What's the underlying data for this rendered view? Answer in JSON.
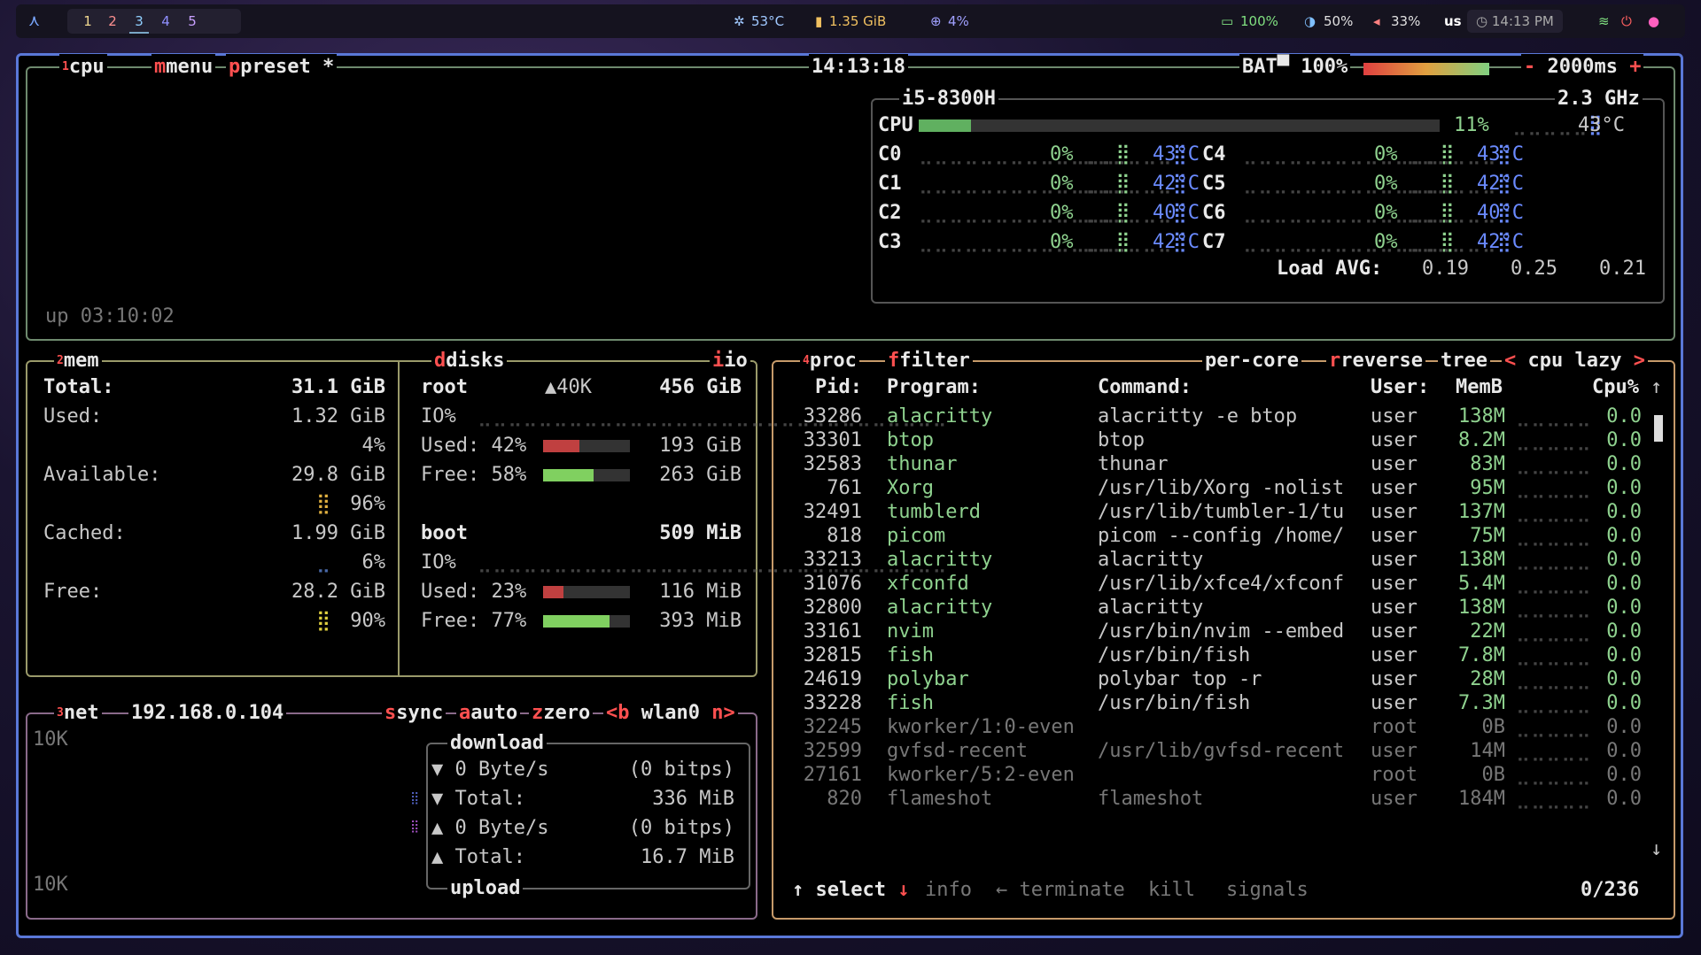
{
  "polybar": {
    "workspaces": [
      "1",
      "2",
      "3",
      "4",
      "5"
    ],
    "temp": "53°C",
    "mem": "1.35 GiB",
    "cpu": "4%",
    "battery": "100%",
    "brightness": "50%",
    "volume": "33%",
    "keyboard": "us",
    "clock": "14:13 PM"
  },
  "cpu": {
    "title": "cpu",
    "menu": "menu",
    "preset": "preset *",
    "clock": "14:13:18",
    "bat": "BAT▀ 100%",
    "interval": "2000ms",
    "model": "i5-8300H",
    "freq": "2.3 GHz",
    "total_label": "CPU",
    "total_pct": "11%",
    "total_temp": "43°C",
    "uptime": "up 03:10:02",
    "cores": [
      {
        "name": "C0",
        "pct": "0%",
        "temp": "43°C"
      },
      {
        "name": "C1",
        "pct": "0%",
        "temp": "42°C"
      },
      {
        "name": "C2",
        "pct": "0%",
        "temp": "40°C"
      },
      {
        "name": "C3",
        "pct": "0%",
        "temp": "42°C"
      },
      {
        "name": "C4",
        "pct": "0%",
        "temp": "43°C"
      },
      {
        "name": "C5",
        "pct": "0%",
        "temp": "42°C"
      },
      {
        "name": "C6",
        "pct": "0%",
        "temp": "40°C"
      },
      {
        "name": "C7",
        "pct": "0%",
        "temp": "42°C"
      }
    ],
    "load_label": "Load AVG:",
    "load": [
      "0.19",
      "0.25",
      "0.21"
    ]
  },
  "mem": {
    "title": "mem",
    "total_label": "Total:",
    "total": "31.1 GiB",
    "used_label": "Used:",
    "used": "1.32 GiB",
    "used_pct": "4%",
    "avail_label": "Available:",
    "avail": "29.8 GiB",
    "avail_pct": "96%",
    "cached_label": "Cached:",
    "cached": "1.99 GiB",
    "cached_pct": "6%",
    "free_label": "Free:",
    "free": "28.2 GiB",
    "free_pct": "90%"
  },
  "disks": {
    "title": "disks",
    "io": "io",
    "root": {
      "name": "root",
      "io_rate": "▲40K",
      "size": "456 GiB",
      "io_label": "IO%",
      "used": "Used: 42%",
      "used_val": "193 GiB",
      "free": "Free: 58%",
      "free_val": "263 GiB",
      "used_fill": 0.42,
      "free_fill": 0.58
    },
    "boot": {
      "name": "boot",
      "size": "509 MiB",
      "io_label": "IO%",
      "used": "Used: 23%",
      "used_val": "116 MiB",
      "free": "Free: 77%",
      "free_val": "393 MiB",
      "used_fill": 0.23,
      "free_fill": 0.77
    }
  },
  "net": {
    "title": "net",
    "ip": "192.168.0.104",
    "sync": "sync",
    "auto": "auto",
    "zero": "zero",
    "iface_prev": "<b",
    "iface": "wlan0",
    "iface_next": "n>",
    "scale_top": "10K",
    "scale_bottom": "10K",
    "download": "download",
    "upload": "upload",
    "dl_rate": "▼ 0 Byte/s",
    "dl_bits": "(0 bitps)",
    "dl_total_label": "▼ Total:",
    "dl_total": "336 MiB",
    "ul_rate": "▲ 0 Byte/s",
    "ul_bits": "(0 bitps)",
    "ul_total_label": "▲ Total:",
    "ul_total": "16.7 MiB"
  },
  "proc": {
    "title": "proc",
    "filter": "filter",
    "per_core": "per-core",
    "reverse": "reverse",
    "tree": "tree",
    "sort": "cpu lazy",
    "headers": {
      "pid": "Pid:",
      "program": "Program:",
      "command": "Command:",
      "user": "User:",
      "mem": "MemB",
      "cpu": "Cpu%"
    },
    "rows": [
      {
        "pid": "33286",
        "program": "alacritty",
        "command": "alacritty -e btop",
        "user": "user",
        "mem": "138M",
        "cpu": "0.0",
        "dim": false
      },
      {
        "pid": "33301",
        "program": "btop",
        "command": "btop",
        "user": "user",
        "mem": "8.2M",
        "cpu": "0.0",
        "dim": false
      },
      {
        "pid": "32583",
        "program": "thunar",
        "command": "thunar",
        "user": "user",
        "mem": "83M",
        "cpu": "0.0",
        "dim": false
      },
      {
        "pid": "761",
        "program": "Xorg",
        "command": "/usr/lib/Xorg -nolist",
        "user": "user",
        "mem": "95M",
        "cpu": "0.0",
        "dim": false
      },
      {
        "pid": "32491",
        "program": "tumblerd",
        "command": "/usr/lib/tumbler-1/tu",
        "user": "user",
        "mem": "137M",
        "cpu": "0.0",
        "dim": false
      },
      {
        "pid": "818",
        "program": "picom",
        "command": "picom --config /home/",
        "user": "user",
        "mem": "75M",
        "cpu": "0.0",
        "dim": false
      },
      {
        "pid": "33213",
        "program": "alacritty",
        "command": "alacritty",
        "user": "user",
        "mem": "138M",
        "cpu": "0.0",
        "dim": false
      },
      {
        "pid": "31076",
        "program": "xfconfd",
        "command": "/usr/lib/xfce4/xfconf",
        "user": "user",
        "mem": "5.4M",
        "cpu": "0.0",
        "dim": false
      },
      {
        "pid": "32800",
        "program": "alacritty",
        "command": "alacritty",
        "user": "user",
        "mem": "138M",
        "cpu": "0.0",
        "dim": false
      },
      {
        "pid": "33161",
        "program": "nvim",
        "command": "/usr/bin/nvim --embed",
        "user": "user",
        "mem": "22M",
        "cpu": "0.0",
        "dim": false
      },
      {
        "pid": "32815",
        "program": "fish",
        "command": "/usr/bin/fish",
        "user": "user",
        "mem": "7.8M",
        "cpu": "0.0",
        "dim": false
      },
      {
        "pid": "24619",
        "program": "polybar",
        "command": "polybar top -r",
        "user": "user",
        "mem": "28M",
        "cpu": "0.0",
        "dim": false
      },
      {
        "pid": "33228",
        "program": "fish",
        "command": "/usr/bin/fish",
        "user": "user",
        "mem": "7.3M",
        "cpu": "0.0",
        "dim": false
      },
      {
        "pid": "32245",
        "program": "kworker/1:0-even",
        "command": "",
        "user": "root",
        "mem": "0B",
        "cpu": "0.0",
        "dim": true
      },
      {
        "pid": "32599",
        "program": "gvfsd-recent",
        "command": "/usr/lib/gvfsd-recent",
        "user": "user",
        "mem": "14M",
        "cpu": "0.0",
        "dim": true
      },
      {
        "pid": "27161",
        "program": "kworker/5:2-even",
        "command": "",
        "user": "root",
        "mem": "0B",
        "cpu": "0.0",
        "dim": true
      },
      {
        "pid": "820",
        "program": "flameshot",
        "command": "flameshot",
        "user": "user",
        "mem": "184M",
        "cpu": "0.0",
        "dim": true
      }
    ],
    "footer": {
      "select": "select",
      "info": "info",
      "terminate": "terminate",
      "kill": "kill",
      "signals": "signals",
      "count": "0/236"
    }
  },
  "colors": {
    "border_accent": "#5a78d8",
    "red": "#ff5050",
    "green": "#8fd28f",
    "blue": "#6a8aff"
  }
}
